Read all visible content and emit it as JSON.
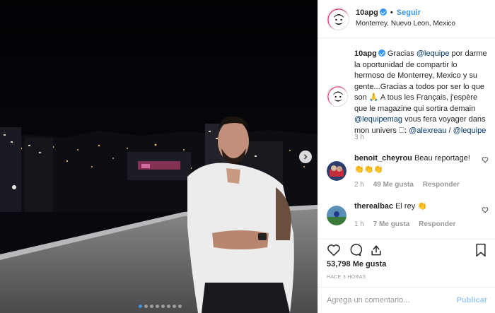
{
  "post": {
    "username": "10apg",
    "follow_label": "Seguir",
    "location": "Monterrey, Nuevo Leon, Mexico",
    "caption_intro": "Gracias ",
    "caption_mention1": "@lequipe",
    "caption_text1": " por darme la oportunidad de compartir lo hermoso de Monterrey, Mexico y su gente...Gracias a todos por ser lo que son 🙏 A tous les Français, j'espère que le magazine qui sortira demain ",
    "caption_mention2": "@lequipemag",
    "caption_text2": " vous fera voyager dans mon univers 🗆: ",
    "caption_mention3": "@alexreau",
    "caption_sep": " / ",
    "caption_mention4": "@lequipe",
    "caption_time": "3 h"
  },
  "comments": [
    {
      "username": "benoit_cheyrou",
      "text": "Beau reportage!👏👏👏",
      "time": "2 h",
      "likes": "49 Me gusta",
      "reply": "Responder"
    },
    {
      "username": "therealbac",
      "text": "El rey 👏",
      "time": "1 h",
      "likes": "7 Me gusta",
      "reply": "Responder"
    }
  ],
  "footer": {
    "likes": "53,798 Me gusta",
    "ago": "HACE 3 HORAS",
    "comment_placeholder": "Agrega un comentario...",
    "publish_label": "Publicar"
  },
  "carousel": {
    "total_dots": 8,
    "active_index": 0
  },
  "colors": {
    "accent": "#3897f0",
    "mention": "#003569",
    "muted": "#999999"
  },
  "icons": [
    "next-arrow-icon",
    "verified-icon",
    "heart-icon",
    "comment-icon",
    "share-icon",
    "bookmark-icon"
  ]
}
